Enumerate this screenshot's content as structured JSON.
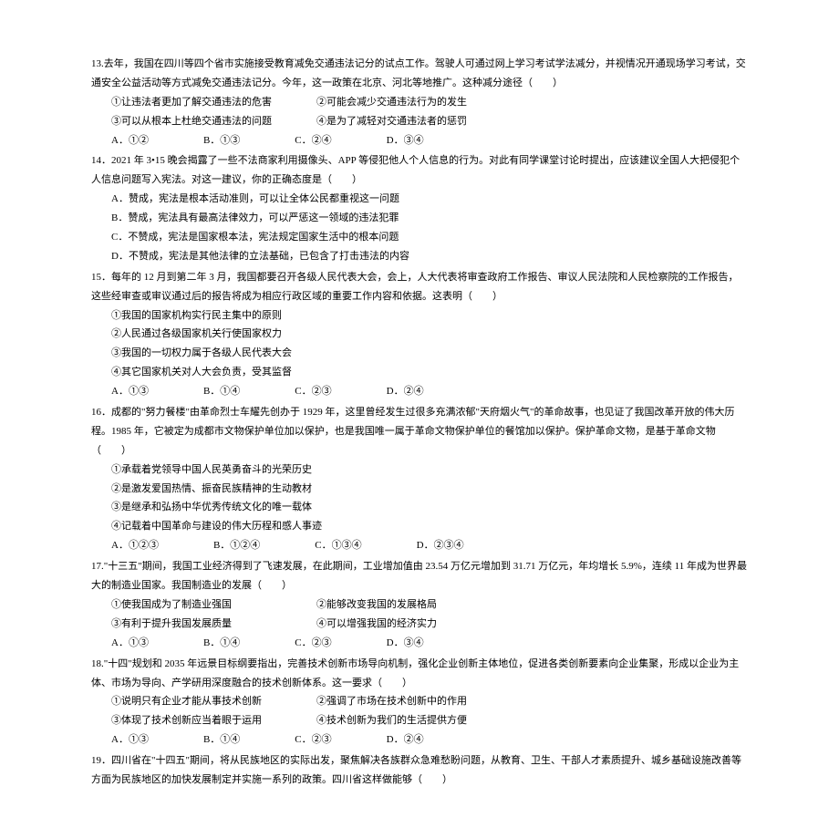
{
  "q13": {
    "stem": "13.去年，我国在四川等四个省市实施接受教育减免交通违法记分的试点工作。驾驶人可通过网上学习考试学法减分，并视情况开通现场学习考试，交通安全公益活动等方式减免交通违法记分。今年，这一政策在北京、河北等地推广。这种减分途径（　　）",
    "s1": "①让违法者更加了解交通违法的危害",
    "s2": "②可能会减少交通违法行为的发生",
    "s3": "③可以从根本上杜绝交通违法的问题",
    "s4": "④是为了减轻对交通违法者的惩罚",
    "a": "A．①②",
    "b": "B．①③",
    "c": "C．②④",
    "d": "D．③④"
  },
  "q14": {
    "stem": "14．2021 年 3•15 晚会揭露了一些不法商家利用摄像头、APP 等侵犯他人个人信息的行为。对此有同学课堂讨论时提出，应该建议全国人大把侵犯个人信息问题写入宪法。对这一建议，你的正确态度是（　　）",
    "a": "A．赞成，宪法是根本活动准则，可以让全体公民都重视这一问题",
    "b": "B．赞成，宪法具有最高法律效力，可以严惩这一领域的违法犯罪",
    "c": "C．不赞成，宪法是国家根本法，宪法规定国家生活中的根本问题",
    "d": "D．不赞成，宪法是其他法律的立法基础，已包含了打击违法的内容"
  },
  "q15": {
    "stem": "15．每年的 12 月到第二年 3 月，我国都要召开各级人民代表大会，会上，人大代表将审查政府工作报告、审议人民法院和人民检察院的工作报告，这些经审查或审议通过后的报告将成为相应行政区域的重要工作内容和依据。这表明（　　）",
    "s1": "①我国的国家机构实行民主集中的原则",
    "s2": "②人民通过各级国家机关行使国家权力",
    "s3": "③我国的一切权力属于各级人民代表大会",
    "s4": "④其它国家机关对人大会负责，受其监督",
    "a": "A．①③",
    "b": "B．①④",
    "c": "C．②③",
    "d": "D．②④"
  },
  "q16": {
    "stem": "16．成都的\"努力餐楼\"由革命烈士车耀先创办于 1929 年，这里曾经发生过很多充满浓郁\"天府烟火气\"的革命故事，也见证了我国改革开放的伟大历程。1985 年，它被定为成都市文物保护单位加以保护，也是我国唯一属于革命文物保护单位的餐馆加以保护。保护革命文物，是基于革命文物（　　）",
    "s1": "①承载着党领导中国人民英勇奋斗的光荣历史",
    "s2": "②是激发爱国热情、振奋民族精神的生动教材",
    "s3": "③是继承和弘扬中华优秀传统文化的唯一载体",
    "s4": "④记载着中国革命与建设的伟大历程和感人事迹",
    "a": "A．①②③",
    "b": "B．①②④",
    "c": "C．①③④",
    "d": "D．②③④"
  },
  "q17": {
    "stem": "17.\"十三五\"期间，我国工业经济得到了飞速发展，在此期间，工业增加值由 23.54 万亿元增加到 31.71 万亿元，年均增长 5.9%，连续 11 年成为世界最大的制造业国家。我国制造业的发展（　　）",
    "s1": "①使我国成为了制造业强国",
    "s2": "②能够改变我国的发展格局",
    "s3": "③有利于提升我国发展质量",
    "s4": "④可以增强我国的经济实力",
    "a": "A．①③",
    "b": "B．①④",
    "c": "C．②③",
    "d": "D．③④"
  },
  "q18": {
    "stem": "18.\"十四\"规划和 2035 年远景目标纲要指出，完善技术创新市场导向机制，强化企业创新主体地位，促进各类创新要素向企业集聚，形成以企业为主体、市场为导向、产学研用深度融合的技术创新体系。这一要求（　　）",
    "s1": "①说明只有企业才能从事技术创新",
    "s2": "②强调了市场在技术创新中的作用",
    "s3": "③体现了技术创新应当着眼于运用",
    "s4": "④技术创新为我们的生活提供方便",
    "a": "A．①③",
    "b": "B．①④",
    "c": "C．②③",
    "d": "D．②④"
  },
  "q19": {
    "stem": "19．四川省在\"十四五\"期间，将从民族地区的实际出发，聚焦解决各族群众急难愁盼问题，从教育、卫生、干部人才素质提升、城乡基础设施改善等方面为民族地区的加快发展制定并实施一系列的政策。四川省这样做能够（　　）"
  }
}
